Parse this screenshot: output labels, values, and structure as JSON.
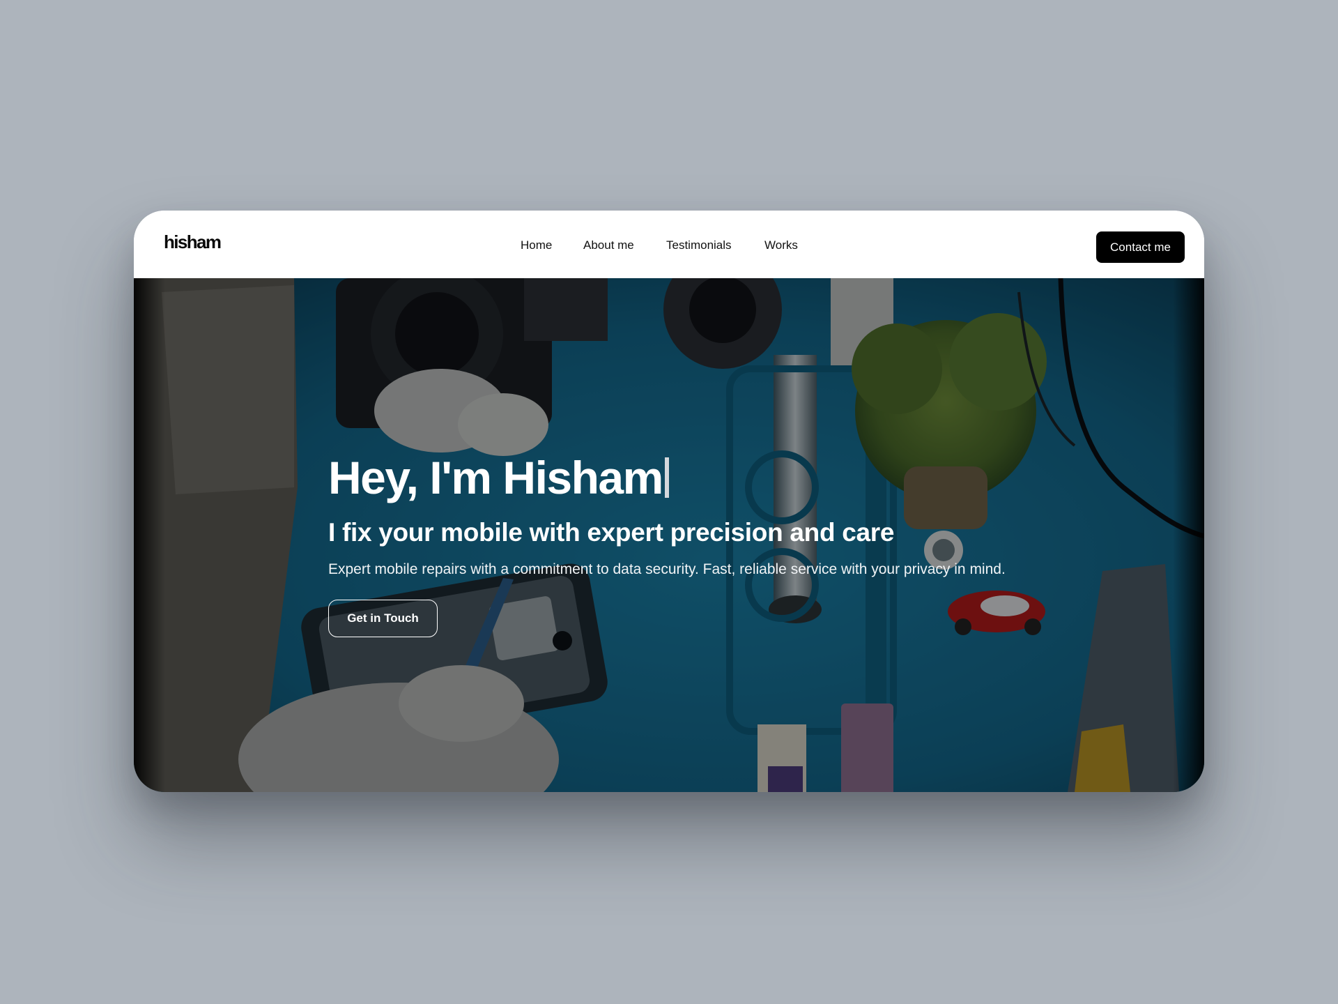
{
  "nav": {
    "logo": "hisham",
    "links": [
      {
        "label": "Home"
      },
      {
        "label": "About me"
      },
      {
        "label": "Testimonials"
      },
      {
        "label": "Works"
      }
    ],
    "cta": "Contact me"
  },
  "hero": {
    "title": "Hey, I'm Hisham",
    "subtitle": "I fix your mobile with expert precision and care",
    "description": "Expert mobile repairs with a commitment to data security. Fast, reliable service with your privacy in mind.",
    "button": "Get in Touch",
    "background_image": "phone repair workbench photo"
  },
  "colors": {
    "page_background": "#adb4bc",
    "navbar": "#ffffff",
    "contact_button": "#000000",
    "hero_tint": "#0d3a4f",
    "text": "#ffffff"
  }
}
